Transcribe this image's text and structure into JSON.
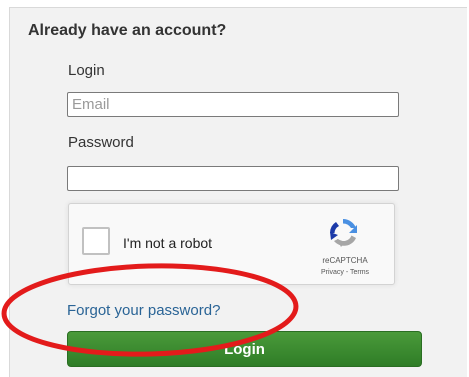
{
  "login_form": {
    "heading": "Already have an account?",
    "login_label": "Login",
    "email_placeholder": "Email",
    "email_value": "",
    "password_label": "Password",
    "password_value": "",
    "forgot_password": "Forgot your password?",
    "login_button": "Login"
  },
  "recaptcha": {
    "label": "I'm not a robot",
    "brand": "reCAPTCHA",
    "privacy": "Privacy",
    "separator": " - ",
    "terms": "Terms",
    "checked": false,
    "logo_icon": "recaptcha-logo-icon"
  },
  "annotation": {
    "shape": "ellipse",
    "color": "#e31b1b",
    "highlights": "forgot_password"
  },
  "colors": {
    "link": "#2a6496",
    "button": "#3a8a30",
    "panel": "#f2f2f2"
  }
}
